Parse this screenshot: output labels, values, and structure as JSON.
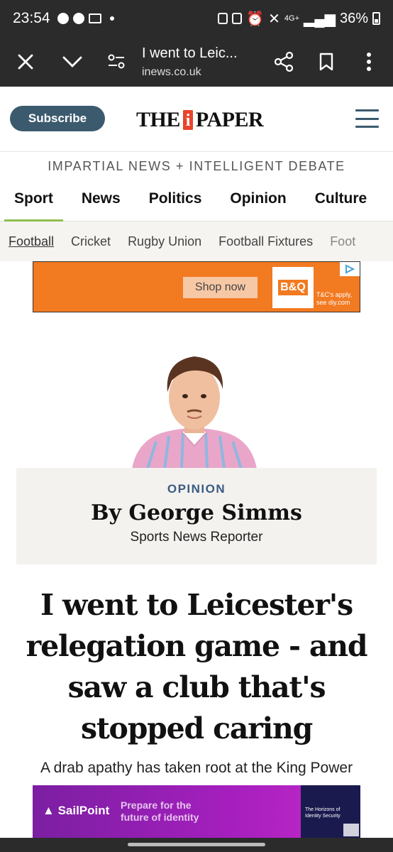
{
  "status_bar": {
    "time": "23:54",
    "network": "4G+",
    "battery": "36%"
  },
  "browser": {
    "tab_title": "I went to Leic...",
    "host": "inews.co.uk"
  },
  "header": {
    "subscribe_label": "Subscribe",
    "logo_left": "THE",
    "logo_i": "i",
    "logo_right": "PAPER"
  },
  "tagline": "IMPARTIAL NEWS + INTELLIGENT DEBATE",
  "main_nav": [
    {
      "label": "Sport",
      "active": true
    },
    {
      "label": "News",
      "active": false
    },
    {
      "label": "Politics",
      "active": false
    },
    {
      "label": "Opinion",
      "active": false
    },
    {
      "label": "Culture",
      "active": false
    }
  ],
  "sub_nav": [
    {
      "label": "Football",
      "active": true
    },
    {
      "label": "Cricket",
      "active": false
    },
    {
      "label": "Rugby Union",
      "active": false
    },
    {
      "label": "Football Fixtures",
      "active": false
    },
    {
      "label": "Foot",
      "active": false
    }
  ],
  "ad_top": {
    "cta": "Shop now",
    "brand": "B&Q",
    "terms_line1": "T&C's apply,",
    "terms_line2": "see diy.com"
  },
  "author": {
    "section": "OPINION",
    "byline": "By George Simms",
    "role": "Sports News Reporter"
  },
  "article": {
    "headline_lines": [
      "I went to Leicester's",
      "relegation game - and",
      "saw a club that's",
      "stopped caring"
    ],
    "standfirst": "A drab apathy has taken root at the King Power"
  },
  "ad_bottom": {
    "brand": "SailPoint",
    "copy_line1": "Prepare for the",
    "copy_line2": "future of identity",
    "book_title_line1": "The Horizons of",
    "book_title_line2": "Identity Security"
  }
}
